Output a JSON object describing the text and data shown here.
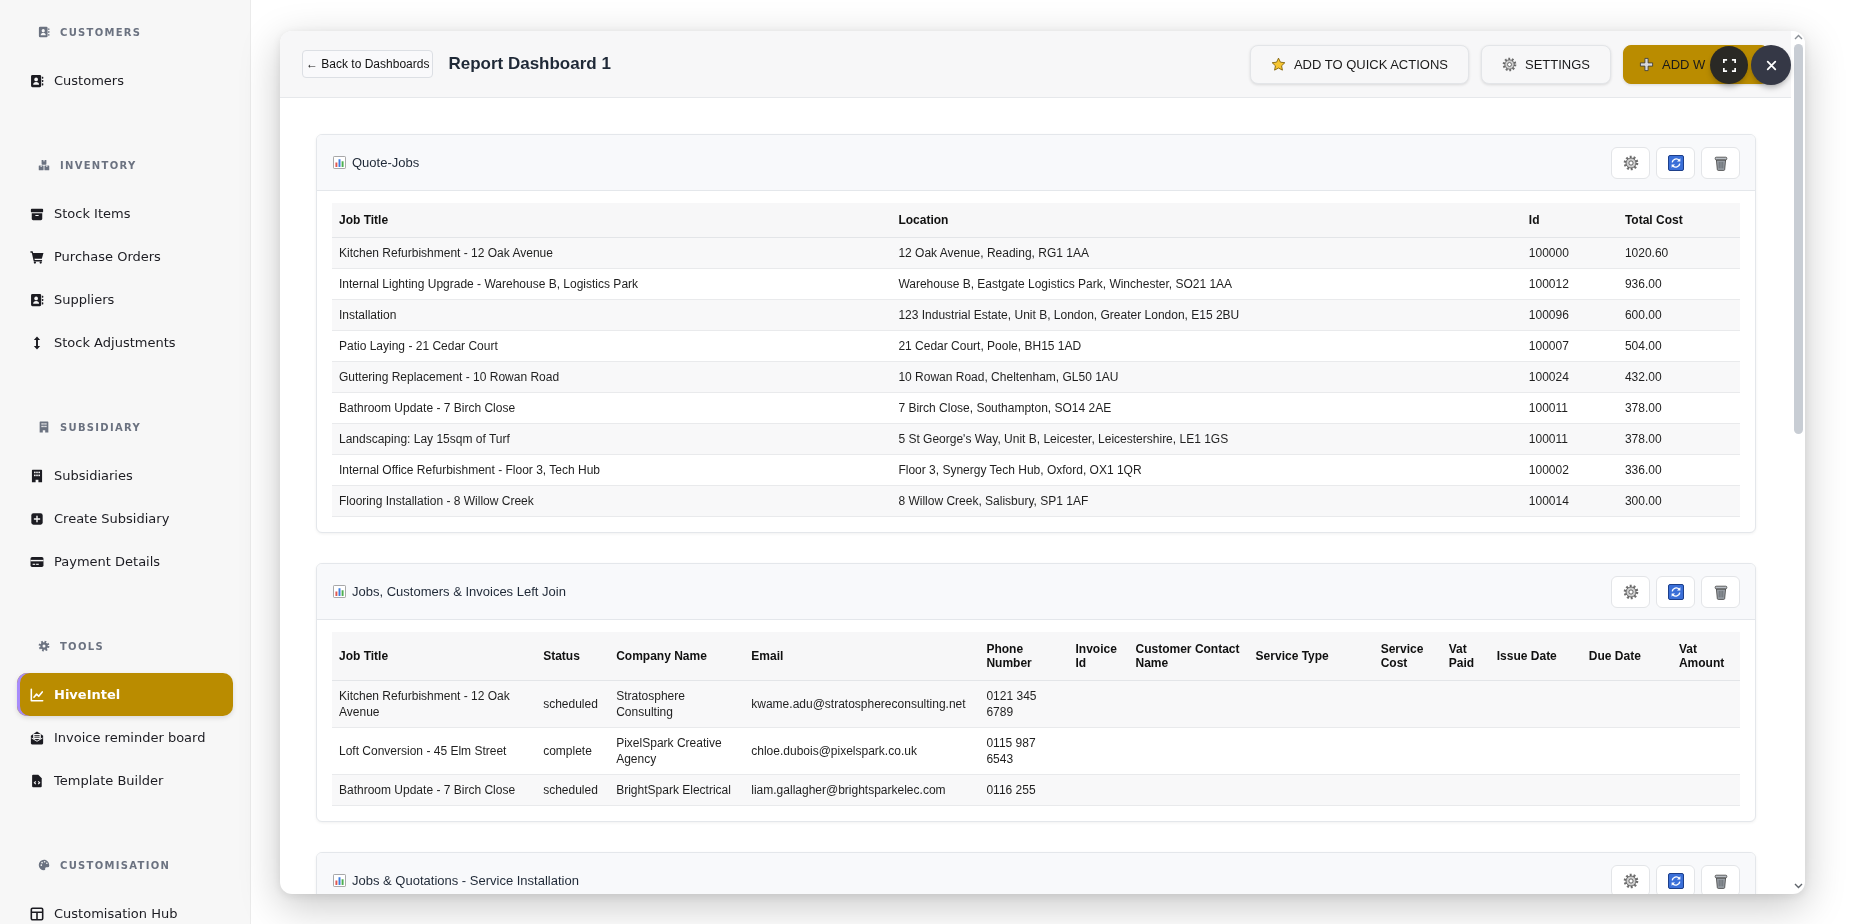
{
  "sidebar": {
    "sections": [
      {
        "title": "CUSTOMERS",
        "items": [
          {
            "label": "Customers",
            "selected": false
          }
        ]
      },
      {
        "title": "INVENTORY",
        "items": [
          {
            "label": "Stock Items",
            "selected": false
          },
          {
            "label": "Purchase Orders",
            "selected": false
          },
          {
            "label": "Suppliers",
            "selected": false
          },
          {
            "label": "Stock Adjustments",
            "selected": false
          }
        ]
      },
      {
        "title": "SUBSIDIARY",
        "items": [
          {
            "label": "Subsidiaries",
            "selected": false
          },
          {
            "label": "Create Subsidiary",
            "selected": false
          },
          {
            "label": "Payment Details",
            "selected": false
          }
        ]
      },
      {
        "title": "TOOLS",
        "items": [
          {
            "label": "HiveIntel",
            "selected": true
          },
          {
            "label": "Invoice reminder board",
            "selected": false
          },
          {
            "label": "Template Builder",
            "selected": false
          }
        ]
      },
      {
        "title": "CUSTOMISATION",
        "items": [
          {
            "label": "Customisation Hub",
            "selected": false
          }
        ]
      }
    ]
  },
  "dashboard": {
    "back_button": "← Back to Dashboards",
    "title": "Report Dashboard 1",
    "actions": [
      {
        "label": "ADD TO QUICK ACTIONS",
        "kind": "secondary"
      },
      {
        "label": "SETTINGS",
        "kind": "secondary"
      },
      {
        "label": "ADD W",
        "kind": "primary"
      }
    ],
    "widgets": [
      {
        "title": "Quote-Jobs",
        "table": {
          "columns": [
            "Job Title",
            "Location",
            "Id",
            "Total Cost"
          ],
          "rows": [
            [
              "Kitchen Refurbishment - 12 Oak Avenue",
              "12 Oak Avenue, Reading, RG1 1AA",
              "100000",
              "1020.60"
            ],
            [
              "Internal Lighting Upgrade - Warehouse B, Logistics Park",
              "Warehouse B, Eastgate Logistics Park, Winchester, SO21 1AA",
              "100012",
              "936.00"
            ],
            [
              "Installation",
              "123 Industrial Estate, Unit B, London, Greater London, E15 2BU",
              "100096",
              "600.00"
            ],
            [
              "Patio Laying - 21 Cedar Court",
              "21 Cedar Court, Poole, BH15 1AD",
              "100007",
              "504.00"
            ],
            [
              "Guttering Replacement - 10 Rowan Road",
              "10 Rowan Road, Cheltenham, GL50 1AU",
              "100024",
              "432.00"
            ],
            [
              "Bathroom Update - 7 Birch Close",
              "7 Birch Close, Southampton, SO14 2AE",
              "100011",
              "378.00"
            ],
            [
              "Landscaping: Lay 15sqm of Turf",
              "5 St George's Way, Unit B, Leicester, Leicestershire, LE1 1GS",
              "100011",
              "378.00"
            ],
            [
              "Internal Office Refurbishment - Floor 3, Tech Hub",
              "Floor 3, Synergy Tech Hub, Oxford, OX1 1QR",
              "100002",
              "336.00"
            ],
            [
              "Flooring Installation - 8 Willow Creek",
              "8 Willow Creek, Salisbury, SP1 1AF",
              "100014",
              "300.00"
            ]
          ]
        }
      },
      {
        "title": "Jobs, Customers & Invoices Left Join",
        "table": {
          "columns": [
            "Job Title",
            "Status",
            "Company Name",
            "Email",
            "Phone Number",
            "Invoice Id",
            "Customer Contact Name",
            "Service Type",
            "Service Cost",
            "Vat Paid",
            "Issue Date",
            "Due Date",
            "Vat Amount"
          ],
          "rows": [
            [
              "Kitchen Refurbishment - 12 Oak Avenue",
              "scheduled",
              "Stratosphere Consulting",
              "kwame.adu@stratosphereconsulting.net",
              "0121 345 6789"
            ],
            [
              "Loft Conversion - 45 Elm Street",
              "complete",
              "PixelSpark Creative Agency",
              "chloe.dubois@pixelspark.co.uk",
              "0115 987 6543"
            ],
            [
              "Bathroom Update - 7 Birch Close",
              "scheduled",
              "BrightSpark Electrical",
              "liam.gallagher@brightsparkelec.com",
              "0116 255"
            ]
          ]
        }
      },
      {
        "title": "Jobs & Quotations - Service Installation"
      }
    ]
  }
}
